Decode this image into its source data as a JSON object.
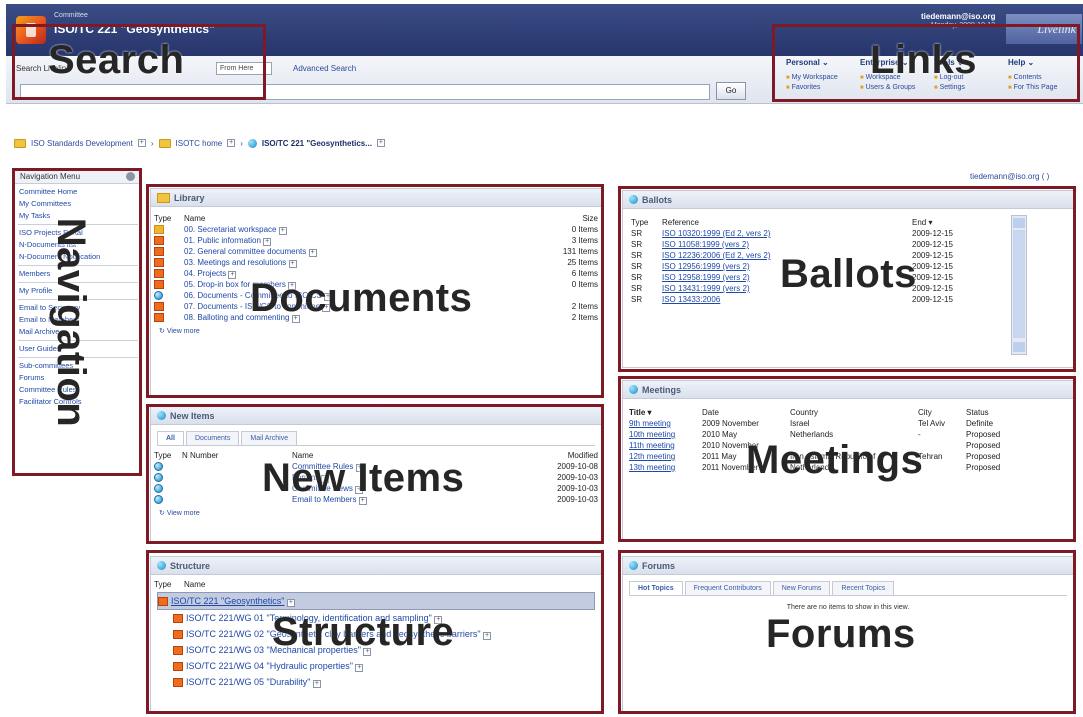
{
  "header": {
    "committee_label": "Committee",
    "committee_title": "ISO/TC 221 \"Geosynthetics\"",
    "user_email": "tiedemann@iso.org",
    "date": "Monday, 2009-10-12",
    "brand": "Livelink"
  },
  "search": {
    "label": "Search Livelink",
    "scope": "From Here",
    "advanced": "Advanced Search",
    "go": "Go"
  },
  "links": {
    "cols": [
      {
        "heading": "Personal ⌄",
        "items": [
          "My Workspace",
          "Favorites"
        ]
      },
      {
        "heading": "Enterprise ⌄",
        "items": [
          "Workspace",
          "Users & Groups"
        ]
      },
      {
        "heading": "Tools ⌄",
        "items": [
          "Log-out",
          "Settings"
        ]
      },
      {
        "heading": "Help ⌄",
        "items": [
          "Contents",
          "For This Page"
        ]
      }
    ]
  },
  "breadcrumb": {
    "items": [
      "ISO Standards Development",
      "ISOTC home",
      "ISO/TC 221 \"Geosynthetics..."
    ],
    "user": "tiedemann@iso.org ( )"
  },
  "navigation": {
    "title": "Navigation Menu",
    "groups": [
      [
        "Committee Home",
        "My Committees",
        "My Tasks"
      ],
      [
        "ISO Projects Portal",
        "N-Documents list",
        "N-Document Notification"
      ],
      [
        "Members"
      ],
      [
        "My Profile"
      ],
      [
        "Email to Secretary",
        "Email to Members",
        "Mail Archive"
      ],
      [
        "User Guides"
      ],
      [
        "Sub-committees",
        "Forums",
        "Committee Rules",
        "Facilitator Controls"
      ]
    ]
  },
  "library": {
    "title": "Library",
    "col_type": "Type",
    "col_name": "Name",
    "col_size": "Size",
    "rows": [
      {
        "icon": "folder",
        "name": "00. Secretariat workspace",
        "size": "0 Items"
      },
      {
        "icon": "folder-red",
        "name": "01. Public information",
        "size": "3 Items"
      },
      {
        "icon": "folder-red",
        "name": "02. General committee documents",
        "size": "131 Items"
      },
      {
        "icon": "folder-red",
        "name": "03. Meetings and resolutions",
        "size": "25 Items"
      },
      {
        "icon": "folder-red",
        "name": "04. Projects",
        "size": "6 Items"
      },
      {
        "icon": "folder-red",
        "name": "05. Drop-in box for members",
        "size": "0 Items"
      },
      {
        "icon": "globe",
        "name": "06. Documents - Committee to ISO/CS",
        "size": ""
      },
      {
        "icon": "folder-red",
        "name": "07. Documents - ISO/CS to committee",
        "size": "2 Items"
      },
      {
        "icon": "folder-red",
        "name": "08. Balloting and commenting",
        "size": "2 Items"
      }
    ],
    "view_more": "View more"
  },
  "new_items": {
    "title": "New Items",
    "tabs": [
      "All",
      "Documents",
      "Mail Archive"
    ],
    "col_type": "Type",
    "col_number": "N Number",
    "col_name": "Name",
    "col_modified": "Modified",
    "rows": [
      {
        "name": "Committee Rules",
        "modified": "2009-10-08"
      },
      {
        "name": "Forums",
        "modified": "2009-10-03"
      },
      {
        "name": "Committee News",
        "modified": "2009-10-03"
      },
      {
        "name": "Email to Members",
        "modified": "2009-10-03"
      }
    ],
    "view_more": "View more"
  },
  "structure": {
    "title": "Structure",
    "col_type": "Type",
    "col_name": "Name",
    "rows": [
      "ISO/TC 221 \"Geosynthetics\"",
      "ISO/TC 221/WG 01 \"Terminology, identification and sampling\"",
      "ISO/TC 221/WG 02 \"Geosynthetic clay barriers and geosynthetic barriers\"",
      "ISO/TC 221/WG 03 \"Mechanical properties\"",
      "ISO/TC 221/WG 04 \"Hydraulic properties\"",
      "ISO/TC 221/WG 05 \"Durability\""
    ]
  },
  "ballots": {
    "title": "Ballots",
    "col_type": "Type",
    "col_ref": "Reference",
    "col_end": "End ▾",
    "rows": [
      {
        "type": "SR",
        "ref": "ISO 10320:1999 (Ed 2, vers 2)",
        "end": "2009-12-15"
      },
      {
        "type": "SR",
        "ref": "ISO 11058:1999 (vers 2)",
        "end": "2009-12-15"
      },
      {
        "type": "SR",
        "ref": "ISO 12236:2006 (Ed 2, vers 2)",
        "end": "2009-12-15"
      },
      {
        "type": "SR",
        "ref": "ISO 12956:1999 (vers 2)",
        "end": "2009-12-15"
      },
      {
        "type": "SR",
        "ref": "ISO 12958:1999 (vers 2)",
        "end": "2009-12-15"
      },
      {
        "type": "SR",
        "ref": "ISO 13431:1999 (vers 2)",
        "end": "2009-12-15"
      },
      {
        "type": "SR",
        "ref": "ISO 13433:2006",
        "end": "2009-12-15"
      }
    ]
  },
  "meetings": {
    "title": "Meetings",
    "col_title": "Title ▾",
    "col_date": "Date",
    "col_country": "Country",
    "col_city": "City",
    "col_status": "Status",
    "rows": [
      {
        "title": "9th meeting",
        "date": "2009 November",
        "country": "Israel",
        "city": "Tel Aviv",
        "status": "Definite"
      },
      {
        "title": "10th meeting",
        "date": "2010 May",
        "country": "Netherlands",
        "city": "-",
        "status": "Proposed"
      },
      {
        "title": "11th meeting",
        "date": "2010 November",
        "country": "",
        "city": "",
        "status": "Proposed"
      },
      {
        "title": "12th meeting",
        "date": "2011 May",
        "country": "Iran, Islamic Republic of",
        "city": "Tehran",
        "status": "Proposed"
      },
      {
        "title": "13th meeting",
        "date": "2011 November",
        "country": "Netherlands",
        "city": "-",
        "status": "Proposed"
      }
    ]
  },
  "forums": {
    "title": "Forums",
    "tabs": [
      "Hot Topics",
      "Frequent Contributors",
      "New Forums",
      "Recent Topics"
    ],
    "empty": "There are no items to show in this view."
  },
  "annotations": {
    "search": "Search",
    "links": "Links",
    "navigation": "Navigation",
    "documents": "Documents",
    "ballots": "Ballots",
    "new_items": "New Items",
    "meetings": "Meetings",
    "structure": "Structure",
    "forums": "Forums"
  }
}
